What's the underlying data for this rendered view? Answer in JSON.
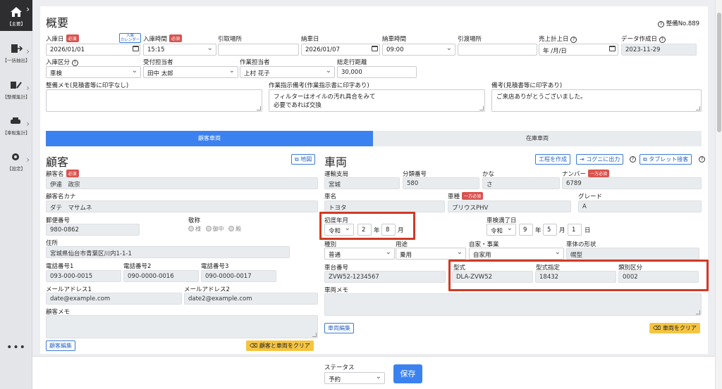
{
  "sidebar": {
    "items": [
      {
        "label": "【主要】",
        "icon": "home-icon"
      },
      {
        "label": "【一括抽出】",
        "icon": "export-icon"
      },
      {
        "label": "【整備集計】",
        "icon": "wrench-icon"
      },
      {
        "label": "【車販集計】",
        "icon": "car-icon"
      },
      {
        "label": "【設定】",
        "icon": "gear-icon"
      }
    ],
    "more": "•••"
  },
  "header": {
    "title": "概要",
    "seibi_no": "整備No.889"
  },
  "form": {
    "nyuko_date_label": "入庫日",
    "required": "必須",
    "nyuko_cal": "入庫\nカレンダー",
    "nyuko_date": "2026/01/01",
    "nyuko_time_label": "入庫時間",
    "nyuko_time": "15:15",
    "hikitori_label": "引取場所",
    "hikitori": "",
    "noushabi_label": "納車日",
    "noushabi": "2026/01/07",
    "nousha_time_label": "納車時間",
    "nousha_time": "09:00",
    "hikiwatashi_label": "引渡場所",
    "hikiwatashi": "",
    "uriage_label": "売上計上日",
    "uriage": "年 /月/日",
    "data_date_label": "データ作成日",
    "data_date": "2023-11-29",
    "nyuko_kubun_label": "入庫区分",
    "nyuko_kubun": "車検",
    "uketsuke_label": "受付担当者",
    "uketsuke": "田中 太郎",
    "sagyo_label": "作業担当者",
    "sagyo": "上村 花子",
    "kyori_label": "総走行距離",
    "kyori": "30,000",
    "memo_label": "整備メモ(見積書等に印字なし)",
    "memo": "",
    "shiji_label": "作業指示備考(作業指示書に印字あり)",
    "shiji_line1": "フィルターはオイルの汚れ具合をみて",
    "shiji_line2": "必要であれば交換",
    "biko_label": "備考(見積書等に印字あり)",
    "biko": "ご来店ありがとうございました。"
  },
  "tabs": {
    "active": "顧客車両",
    "inactive": "在庫車両"
  },
  "customer": {
    "title": "顧客",
    "map_button": "地図",
    "name_label": "顧客名",
    "name": "伊達　政宗",
    "kana_label": "顧客名カナ",
    "kana": "ダテ　マサムネ",
    "zip_label": "郵便番号",
    "zip": "980-0862",
    "honorific_label": "敬称",
    "honorifics": [
      "様",
      "御中",
      "殿"
    ],
    "address_label": "住所",
    "address": "宮城県仙台市青葉区川内1-1-1",
    "tel1_label": "電話番号1",
    "tel1": "093-000-0015",
    "tel2_label": "電話番号2",
    "tel2": "090-0000-0016",
    "tel3_label": "電話番号3",
    "tel3": "090-0000-0017",
    "mail1_label": "メールアドレス1",
    "mail1": "date@example.com",
    "mail2_label": "メールアドレス2",
    "mail2": "date2@example.com",
    "memo_label": "顧客メモ",
    "memo": "",
    "edit_button": "顧客編集",
    "clear_button": "顧客と車両をクリア"
  },
  "vehicle": {
    "title": "車両",
    "process_button": "工程を作成",
    "cogni_button": "コグニに出力",
    "tablet_button": "タブレット接客",
    "unyu_label": "運輸支局",
    "unyu": "宮城",
    "bunrui_label": "分類番号",
    "bunrui": "580",
    "kana_label": "かな",
    "kana": "さ",
    "number_label": "ナンバー",
    "number_badge": "一方必須",
    "number": "6789",
    "maker_label": "車名",
    "maker": "トヨタ",
    "shashu_label": "車種",
    "shashu_badge": "一方必須",
    "shashu": "プリウスPHV",
    "grade_label": "グレード",
    "grade": "A",
    "shodo_label": "初度年月",
    "shodo_era": "令和",
    "shodo_year": "2",
    "shodo_year_unit": "年",
    "shodo_month": "8",
    "shodo_month_unit": "月",
    "shaken_label": "車検満了日",
    "shaken_era": "令和",
    "shaken_year": "9",
    "shaken_year_unit": "年",
    "shaken_month": "5",
    "shaken_month_unit": "月",
    "shaken_day": "1",
    "shaken_day_unit": "日",
    "shubetsu_label": "種別",
    "shubetsu": "普通",
    "yoto_label": "用途",
    "yoto": "乗用",
    "jika_label": "自家・事業",
    "jika": "自家用",
    "keijo_label": "車体の形状",
    "keijo": "幌型",
    "chassis_label": "車台番号",
    "chassis": "ZVW52-1234567",
    "katashiki_label": "型式",
    "katashiki": "DLA-ZVW52",
    "katashiki_shitei_label": "型式指定",
    "katashiki_shitei": "18432",
    "ruibetsu_label": "類別区分",
    "ruibetsu": "0002",
    "memo_label": "車両メモ",
    "memo": "",
    "edit_button": "車両編集",
    "clear_button": "車両をクリア"
  },
  "footer": {
    "status_label": "ステータス",
    "status": "予約",
    "save": "保存"
  },
  "colors": {
    "accent": "#3b82f0",
    "required": "#d9534f",
    "highlight": "#d03a25",
    "warning": "#f5c542"
  }
}
